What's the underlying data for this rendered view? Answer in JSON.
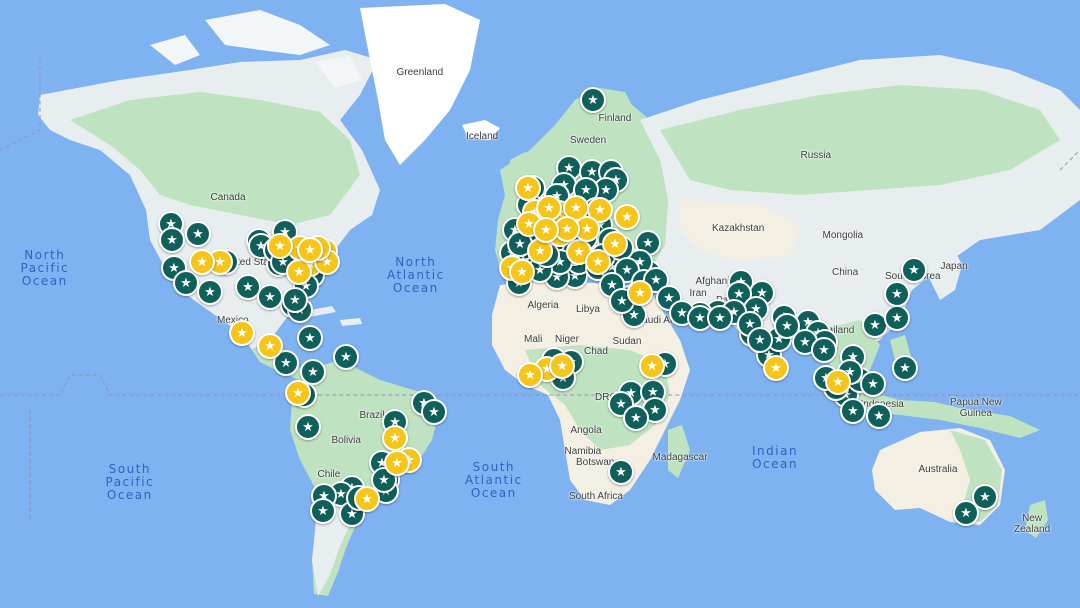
{
  "colors": {
    "ocean": "#7fb2f0",
    "land": "#e8eef0",
    "vegetation": "#bfe3c1",
    "ice": "#ffffff",
    "desert": "#f4efe3",
    "marker_green": "#0f5f5b",
    "marker_yellow": "#f5c518",
    "marker_purple": "#9b2fae"
  },
  "ocean_labels": [
    {
      "text": "North\nPacific\nOcean"
    },
    {
      "text": "North\nAtlantic\nOcean"
    },
    {
      "text": "South\nPacific\nOcean"
    },
    {
      "text": "South\nAtlantic\nOcean"
    },
    {
      "text": "Indian\nOcean"
    }
  ],
  "land_labels": [
    {
      "text": "Greenland"
    },
    {
      "text": "Iceland"
    },
    {
      "text": "Finland"
    },
    {
      "text": "Sweden"
    },
    {
      "text": "Russia"
    },
    {
      "text": "Canada"
    },
    {
      "text": "United States"
    },
    {
      "text": "Mexico"
    },
    {
      "text": "Kazakhstan"
    },
    {
      "text": "Mongolia"
    },
    {
      "text": "China"
    },
    {
      "text": "Japan"
    },
    {
      "text": "South Korea"
    },
    {
      "text": "Iran"
    },
    {
      "text": "Afghanistan"
    },
    {
      "text": "Pakistan"
    },
    {
      "text": "Saudi Arabia"
    },
    {
      "text": "Thailand"
    },
    {
      "text": "Indonesia"
    },
    {
      "text": "Papua New\nGuinea"
    },
    {
      "text": "Australia"
    },
    {
      "text": "New\nZealand"
    },
    {
      "text": "Algeria"
    },
    {
      "text": "Libya"
    },
    {
      "text": "Mali"
    },
    {
      "text": "Niger"
    },
    {
      "text": "Chad"
    },
    {
      "text": "Sudan"
    },
    {
      "text": "DRC"
    },
    {
      "text": "Angola"
    },
    {
      "text": "Namibia"
    },
    {
      "text": "Botswana"
    },
    {
      "text": "South Africa"
    },
    {
      "text": "Madagascar"
    },
    {
      "text": "Brazil"
    },
    {
      "text": "Bolivia"
    },
    {
      "text": "Chile"
    }
  ],
  "markers": [
    {
      "type": "green"
    },
    {
      "type": "green"
    },
    {
      "type": "green"
    },
    {
      "type": "green"
    },
    {
      "type": "green"
    },
    {
      "type": "green"
    },
    {
      "type": "green"
    },
    {
      "type": "green"
    },
    {
      "type": "green"
    },
    {
      "type": "green"
    },
    {
      "type": "green"
    },
    {
      "type": "green"
    },
    {
      "type": "green"
    },
    {
      "type": "green"
    },
    {
      "type": "green"
    },
    {
      "type": "green"
    },
    {
      "type": "green"
    },
    {
      "type": "green"
    },
    {
      "type": "green"
    },
    {
      "type": "green"
    },
    {
      "type": "green"
    },
    {
      "type": "green"
    },
    {
      "type": "green"
    },
    {
      "type": "green"
    },
    {
      "type": "green"
    },
    {
      "type": "green"
    },
    {
      "type": "green"
    },
    {
      "type": "green"
    },
    {
      "type": "green"
    },
    {
      "type": "green"
    },
    {
      "type": "green"
    },
    {
      "type": "green"
    },
    {
      "type": "green"
    },
    {
      "type": "green"
    },
    {
      "type": "green"
    },
    {
      "type": "green"
    },
    {
      "type": "green"
    },
    {
      "type": "green"
    },
    {
      "type": "green"
    },
    {
      "type": "green"
    },
    {
      "type": "green"
    },
    {
      "type": "green"
    },
    {
      "type": "green"
    },
    {
      "type": "green"
    },
    {
      "type": "green"
    },
    {
      "type": "green"
    },
    {
      "type": "green"
    },
    {
      "type": "green"
    },
    {
      "type": "green"
    },
    {
      "type": "green"
    },
    {
      "type": "green"
    },
    {
      "type": "green"
    },
    {
      "type": "green"
    },
    {
      "type": "green"
    },
    {
      "type": "green"
    },
    {
      "type": "green"
    },
    {
      "type": "green"
    },
    {
      "type": "green"
    },
    {
      "type": "green"
    },
    {
      "type": "green"
    },
    {
      "type": "green"
    },
    {
      "type": "green"
    },
    {
      "type": "green"
    },
    {
      "type": "green"
    },
    {
      "type": "green"
    },
    {
      "type": "green"
    },
    {
      "type": "green"
    },
    {
      "type": "green"
    },
    {
      "type": "green"
    },
    {
      "type": "green"
    },
    {
      "type": "green"
    },
    {
      "type": "green"
    },
    {
      "type": "green"
    },
    {
      "type": "green"
    },
    {
      "type": "green"
    },
    {
      "type": "green"
    },
    {
      "type": "green"
    },
    {
      "type": "green"
    },
    {
      "type": "green"
    },
    {
      "type": "green"
    },
    {
      "type": "green"
    },
    {
      "type": "green"
    },
    {
      "type": "green"
    },
    {
      "type": "green"
    },
    {
      "type": "green"
    },
    {
      "type": "green"
    },
    {
      "type": "green"
    },
    {
      "type": "green"
    },
    {
      "type": "green"
    },
    {
      "type": "green"
    },
    {
      "type": "green"
    },
    {
      "type": "green"
    },
    {
      "type": "green"
    },
    {
      "type": "green"
    },
    {
      "type": "green"
    },
    {
      "type": "green"
    },
    {
      "type": "green"
    },
    {
      "type": "green"
    },
    {
      "type": "green"
    },
    {
      "type": "green"
    },
    {
      "type": "green"
    },
    {
      "type": "green"
    },
    {
      "type": "green"
    },
    {
      "type": "green"
    },
    {
      "type": "green"
    },
    {
      "type": "green"
    },
    {
      "type": "green"
    },
    {
      "type": "green"
    },
    {
      "type": "green"
    },
    {
      "type": "green"
    },
    {
      "type": "green"
    },
    {
      "type": "green"
    },
    {
      "type": "green"
    },
    {
      "type": "green"
    },
    {
      "type": "green"
    },
    {
      "type": "green"
    },
    {
      "type": "green"
    },
    {
      "type": "green"
    },
    {
      "type": "green"
    },
    {
      "type": "green"
    },
    {
      "type": "green"
    },
    {
      "type": "green"
    },
    {
      "type": "green"
    },
    {
      "type": "green"
    },
    {
      "type": "green"
    },
    {
      "type": "green"
    },
    {
      "type": "green"
    },
    {
      "type": "green"
    },
    {
      "type": "green"
    },
    {
      "type": "green"
    },
    {
      "type": "green"
    },
    {
      "type": "green"
    },
    {
      "type": "green"
    },
    {
      "type": "green"
    },
    {
      "type": "green"
    },
    {
      "type": "green"
    },
    {
      "type": "green"
    },
    {
      "type": "green"
    },
    {
      "type": "green"
    },
    {
      "type": "green"
    },
    {
      "type": "green"
    },
    {
      "type": "green"
    },
    {
      "type": "green"
    },
    {
      "type": "green"
    },
    {
      "type": "green"
    },
    {
      "type": "green"
    },
    {
      "type": "green"
    },
    {
      "type": "green"
    },
    {
      "type": "green"
    },
    {
      "type": "green"
    },
    {
      "type": "yellow"
    },
    {
      "type": "yellow"
    },
    {
      "type": "yellow"
    },
    {
      "type": "yellow"
    },
    {
      "type": "yellow"
    },
    {
      "type": "yellow"
    },
    {
      "type": "yellow"
    },
    {
      "type": "yellow"
    },
    {
      "type": "yellow"
    },
    {
      "type": "yellow"
    },
    {
      "type": "yellow"
    },
    {
      "type": "yellow"
    },
    {
      "type": "yellow"
    },
    {
      "type": "yellow"
    },
    {
      "type": "yellow"
    },
    {
      "type": "yellow"
    },
    {
      "type": "yellow"
    },
    {
      "type": "yellow"
    },
    {
      "type": "yellow"
    },
    {
      "type": "yellow"
    },
    {
      "type": "yellow"
    },
    {
      "type": "yellow"
    },
    {
      "type": "yellow"
    },
    {
      "type": "yellow"
    },
    {
      "type": "yellow"
    },
    {
      "type": "yellow"
    },
    {
      "type": "yellow"
    },
    {
      "type": "yellow"
    },
    {
      "type": "yellow"
    },
    {
      "type": "yellow"
    },
    {
      "type": "yellow"
    },
    {
      "type": "yellow"
    },
    {
      "type": "yellow"
    },
    {
      "type": "yellow"
    },
    {
      "type": "yellow"
    },
    {
      "type": "yellow"
    },
    {
      "type": "yellow"
    },
    {
      "type": "yellow"
    },
    {
      "type": "yellow"
    },
    {
      "type": "yellow"
    },
    {
      "type": "yellow"
    },
    {
      "type": "yellow"
    },
    {
      "type": "yellow"
    },
    {
      "type": "yellow"
    },
    {
      "type": "yellow"
    },
    {
      "type": "yellow"
    },
    {
      "type": "yellow"
    },
    {
      "type": "yellow"
    },
    {
      "type": "yellow"
    },
    {
      "type": "yellow"
    },
    {
      "type": "yellow"
    },
    {
      "type": "yellow"
    },
    {
      "type": "yellow"
    },
    {
      "type": "yellow"
    },
    {
      "type": "yellow"
    },
    {
      "type": "yellow"
    },
    {
      "type": "yellow"
    },
    {
      "type": "yellow"
    },
    {
      "type": "yellow"
    },
    {
      "type": "yellow"
    },
    {
      "type": "yellow"
    },
    {
      "type": "yellow"
    },
    {
      "type": "yellow"
    },
    {
      "type": "yellow"
    },
    {
      "type": "yellow"
    },
    {
      "type": "yellow"
    },
    {
      "type": "yellow"
    },
    {
      "type": "purple"
    },
    {
      "type": "purple"
    },
    {
      "type": "purple"
    }
  ]
}
